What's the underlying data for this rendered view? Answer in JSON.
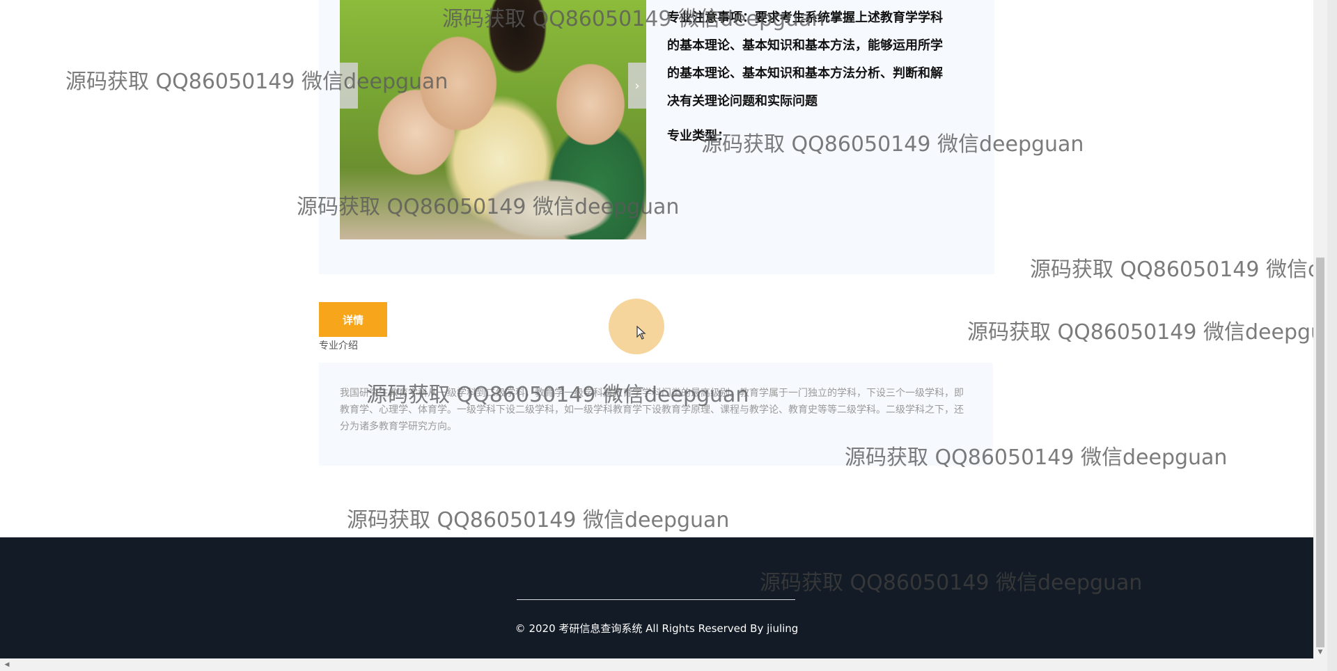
{
  "info": {
    "notes_line1": "专业注意事项：要求考生系统掌握上述教育学学科",
    "notes_line2": "的基本理论、基本知识和基本方法，能够运用所学",
    "notes_line3": "的基本理论、基本知识和基本方法分析、判断和解",
    "notes_line4": "决有关理论问题和实际问题",
    "type_label": "专业类型："
  },
  "carousel": {
    "prev_glyph": "‹",
    "next_glyph": "›"
  },
  "detail": {
    "button_label": "详情",
    "section_label": "专业介绍",
    "intro_text": "我国研究生教育学科从一级学科到二级学科，教育学一级学科是教育学学科门类的最高级别。教育学属于一门独立的学科，下设三个一级学科，即教育学、心理学、体育学。一级学科下设二级学科，如一级学科教育学下设教育学原理、课程与教学论、教育史等等二级学科。二级学科之下，还分为诸多教育学研究方向。"
  },
  "footer": {
    "copyright": "© 2020 考研信息查询系统 All Rights Reserved By jiuling"
  },
  "watermark": {
    "text": "源码获取 QQ86050149 微信deepguan",
    "text_clipped": "源码获取 QQ86050149 微信dee"
  },
  "colors": {
    "accent": "#f7a51b",
    "footer_bg": "#131b26",
    "card_bg": "#f6f9fd"
  },
  "icons": {
    "prev": "chevron-left-icon",
    "next": "chevron-right-icon",
    "cursor": "mouse-pointer-icon"
  }
}
